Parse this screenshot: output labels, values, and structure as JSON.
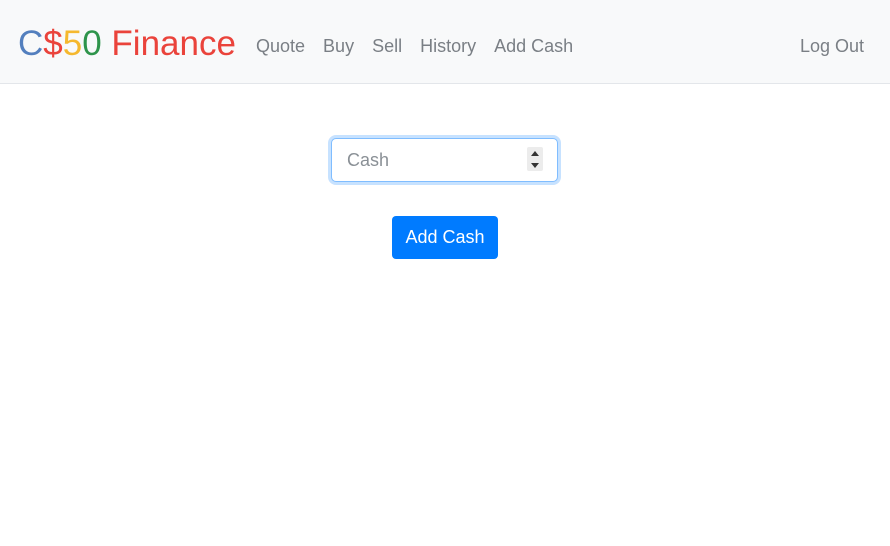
{
  "navbar": {
    "brand": {
      "part1": "C",
      "part2": "$",
      "part3": "5",
      "part4": "0",
      "part5": " Finance"
    },
    "links": [
      {
        "label": "Quote"
      },
      {
        "label": "Buy"
      },
      {
        "label": "Sell"
      },
      {
        "label": "History"
      },
      {
        "label": "Add Cash"
      }
    ],
    "logout_label": "Log Out"
  },
  "form": {
    "cash_input": {
      "placeholder": "Cash",
      "value": ""
    },
    "submit_label": "Add Cash"
  },
  "colors": {
    "brand_blue": "#537fbe",
    "brand_red": "#ea433b",
    "brand_yellow": "#f5b82e",
    "brand_green": "#2e944b",
    "button_primary": "#007bff",
    "navbar_bg": "#f8f9fa",
    "nav_link": "#7a7f85"
  }
}
